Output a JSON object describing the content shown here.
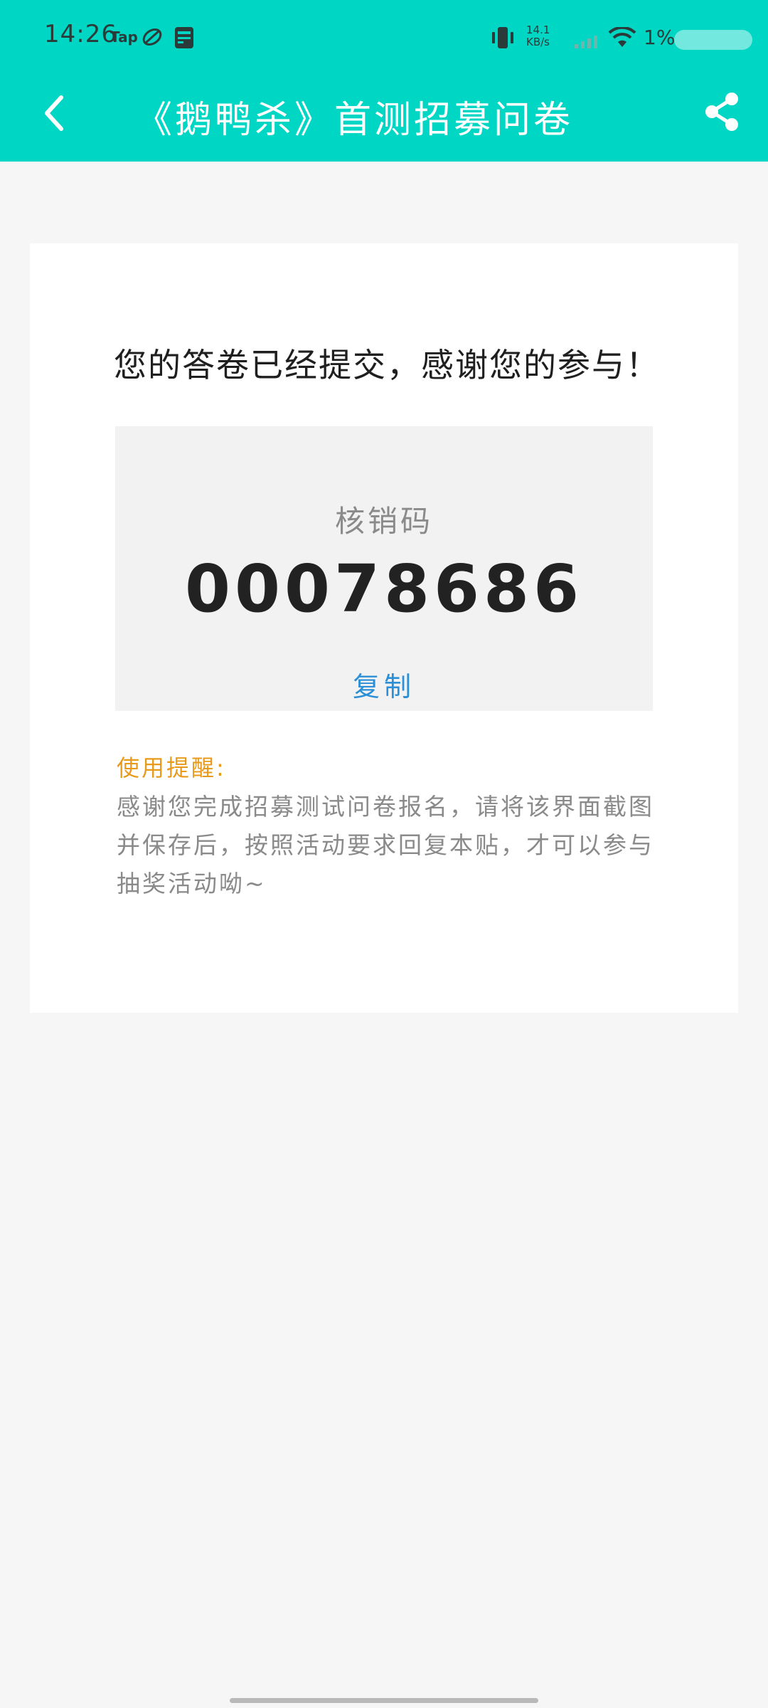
{
  "status_bar": {
    "time": "14:26",
    "tap_label": "Tap",
    "net_speed_value": "14.1",
    "net_speed_unit": "KB/s",
    "battery_percent": "1%"
  },
  "nav": {
    "title": "《鹅鸭杀》首测招募问卷",
    "back_icon": "chevron-left-icon",
    "share_icon": "share-icon"
  },
  "result": {
    "message": "您的答卷已经提交，感谢您的参与！",
    "code_label": "核销码",
    "code_value": "00078686",
    "copy_label": "复制"
  },
  "tips": {
    "title": "使用提醒:",
    "text": "感谢您完成招募测试问卷报名，请将该界面截图并保存后，按照活动要求回复本贴，才可以参与抽奖活动呦~"
  },
  "colors": {
    "header": "#00d6c4",
    "background": "#f6f6f6",
    "card": "#ffffff",
    "code_box": "#f2f2f2",
    "tips_title": "#e89a1a",
    "copy_link": "#2a8fd6"
  }
}
